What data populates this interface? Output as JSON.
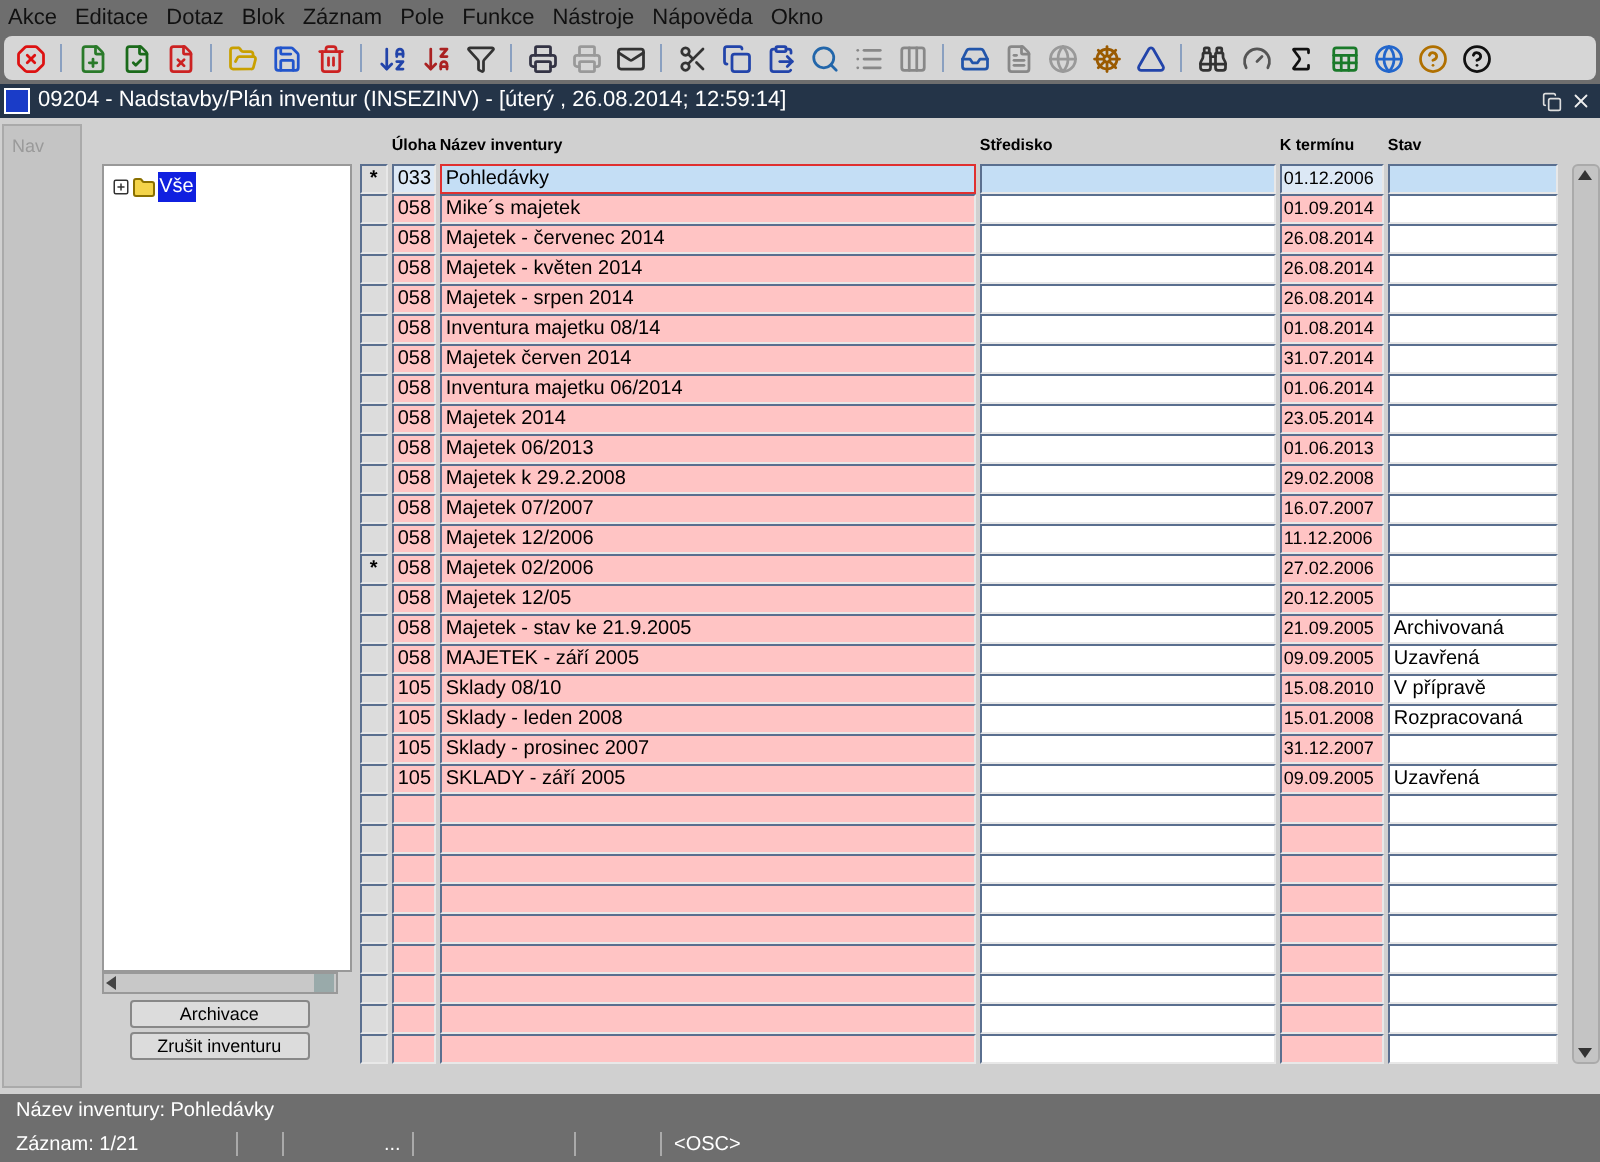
{
  "menu": [
    "Akce",
    "Editace",
    "Dotaz",
    "Blok",
    "Záznam",
    "Pole",
    "Funkce",
    "Nástroje",
    "Nápověda",
    "Okno"
  ],
  "window": {
    "title": "09204 - Nadstavby/Plán inventur (INSEZINV) - [úterý  , 26.08.2014; 12:59:14]"
  },
  "nav_tab": {
    "label": "Nav",
    "disabled": true
  },
  "tree": [
    {
      "label": "Vše",
      "selected": true,
      "expanded": false
    }
  ],
  "buttons": [
    "Archivace",
    "Zrušit inventuru"
  ],
  "table": {
    "columns": [
      "Úloha",
      "Název inventury",
      "Středisko",
      "K termínu",
      "Stav"
    ],
    "rows": [
      {
        "marker": "*",
        "task": "033",
        "name": "Pohledávky",
        "due": "01.12.2006",
        "selected": true
      },
      {
        "task": "058",
        "name": "Mike´s majetek",
        "due": "01.09.2014",
        "selected": false
      },
      {
        "task": "058",
        "name": "Majetek - červenec 2014",
        "due": "26.08.2014",
        "selected": false
      },
      {
        "task": "058",
        "name": "Majetek - květen 2014",
        "due": "26.08.2014",
        "selected": false
      },
      {
        "task": "058",
        "name": "Majetek - srpen 2014",
        "due": "26.08.2014",
        "selected": false
      },
      {
        "task": "058",
        "name": "Inventura majetku 08/14",
        "due": "01.08.2014",
        "selected": false
      },
      {
        "task": "058",
        "name": "Majetek červen 2014",
        "due": "31.07.2014",
        "selected": false
      },
      {
        "task": "058",
        "name": "Inventura majetku 06/2014",
        "due": "01.06.2014",
        "selected": false
      },
      {
        "task": "058",
        "name": "Majetek 2014",
        "due": "23.05.2014",
        "selected": false
      },
      {
        "task": "058",
        "name": "Majetek 06/2013",
        "due": "01.06.2013",
        "selected": false
      },
      {
        "task": "058",
        "name": "Majetek k 29.2.2008",
        "due": "29.02.2008",
        "selected": false
      },
      {
        "task": "058",
        "name": "Majetek 07/2007",
        "due": "16.07.2007",
        "selected": false
      },
      {
        "task": "058",
        "name": "Majetek 12/2006",
        "due": "11.12.2006",
        "selected": false
      },
      {
        "marker": "*",
        "task": "058",
        "name": "Majetek 02/2006",
        "due": "27.02.2006",
        "selected": false
      },
      {
        "task": "058",
        "name": "Majetek 12/05",
        "due": "20.12.2005",
        "selected": false
      },
      {
        "task": "058",
        "name": "Majetek - stav ke 21.9.2005",
        "due": "21.09.2005",
        "status": "Archivovaná",
        "selected": false
      },
      {
        "task": "058",
        "name": "MAJETEK - září 2005",
        "due": "09.09.2005",
        "status": "Uzavřená",
        "selected": false
      },
      {
        "task": "105",
        "name": "Sklady 08/10",
        "due": "15.08.2010",
        "status": "V přípravě",
        "selected": false
      },
      {
        "task": "105",
        "name": "Sklady - leden 2008",
        "due": "15.01.2008",
        "status": "Rozpracovaná",
        "selected": false
      },
      {
        "task": "105",
        "name": "Sklady - prosinec 2007",
        "due": "31.12.2007",
        "selected": false
      },
      {
        "task": "105",
        "name": "SKLADY - září 2005",
        "due": "09.09.2005",
        "status": "Uzavřená",
        "selected": false
      }
    ]
  },
  "status_bar": {
    "message": "Název inventury: Pohledávky",
    "record": "Záznam: 1/21",
    "ellipsis": "...",
    "mode": "<OSC>"
  }
}
